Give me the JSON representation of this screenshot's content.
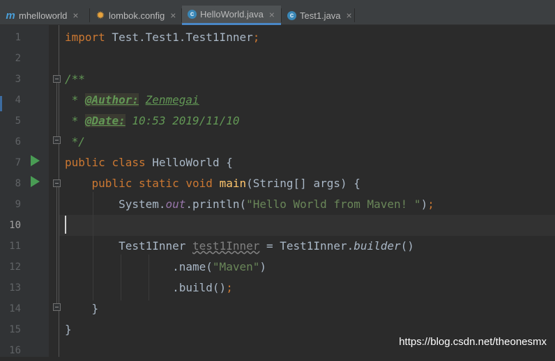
{
  "tabs": [
    {
      "label": "mhelloworld",
      "icon": "m-icon",
      "active": false
    },
    {
      "label": "lombok.config",
      "icon": "gear-icon",
      "active": false
    },
    {
      "label": "HelloWorld.java",
      "icon": "class-icon",
      "active": true
    },
    {
      "label": "Test1.java",
      "icon": "class-icon",
      "active": false
    }
  ],
  "tab_icon_glyphs": {
    "m": "m",
    "gear": "✹",
    "class": "c",
    "close": "×"
  },
  "editor": {
    "current_line": 10,
    "line_numbers": [
      "1",
      "2",
      "3",
      "4",
      "5",
      "6",
      "7",
      "8",
      "9",
      "10",
      "11",
      "12",
      "13",
      "14",
      "15",
      "16"
    ],
    "code": {
      "l1": {
        "kw_import": "import",
        "path": " Test.Test1.Test1Inner",
        "semi": ";"
      },
      "l3": {
        "doc_open": "/**"
      },
      "l4": {
        "star": " * ",
        "tag": "@Author:",
        "space": " ",
        "value": "Zenmegai"
      },
      "l5": {
        "star": " * ",
        "tag": "@Date:",
        "space": " ",
        "value": "10:53 2019/11/10"
      },
      "l6": {
        "doc_close": " */"
      },
      "l7": {
        "kw_public": "public",
        "sp1": " ",
        "kw_class": "class",
        "rest": " HelloWorld {"
      },
      "l8": {
        "indent": "    ",
        "kw_public": "public",
        "sp1": " ",
        "kw_static": "static",
        "sp2": " ",
        "kw_void": "void",
        "sp3": " ",
        "method": "main",
        "rest": "(String[] args) {"
      },
      "l9": {
        "indent": "        ",
        "sys": "System.",
        "out": "out",
        "println": ".println(",
        "str": "\"Hello World from Maven! \"",
        "close": ")",
        "semi": ";"
      },
      "l11": {
        "indent": "        ",
        "type": "Test1Inner ",
        "var": "test1Inner",
        "eq": " = Test1Inner.",
        "builder": "builder",
        "paren": "()"
      },
      "l12": {
        "indent": "                ",
        "name": ".name(",
        "str": "\"Maven\"",
        "close": ")"
      },
      "l13": {
        "indent": "                ",
        "build": ".build()",
        "semi": ";"
      },
      "l14": {
        "indent": "    ",
        "brace": "}"
      },
      "l15": {
        "brace": "}"
      }
    }
  },
  "watermark": "https://blog.csdn.net/theonesmx"
}
